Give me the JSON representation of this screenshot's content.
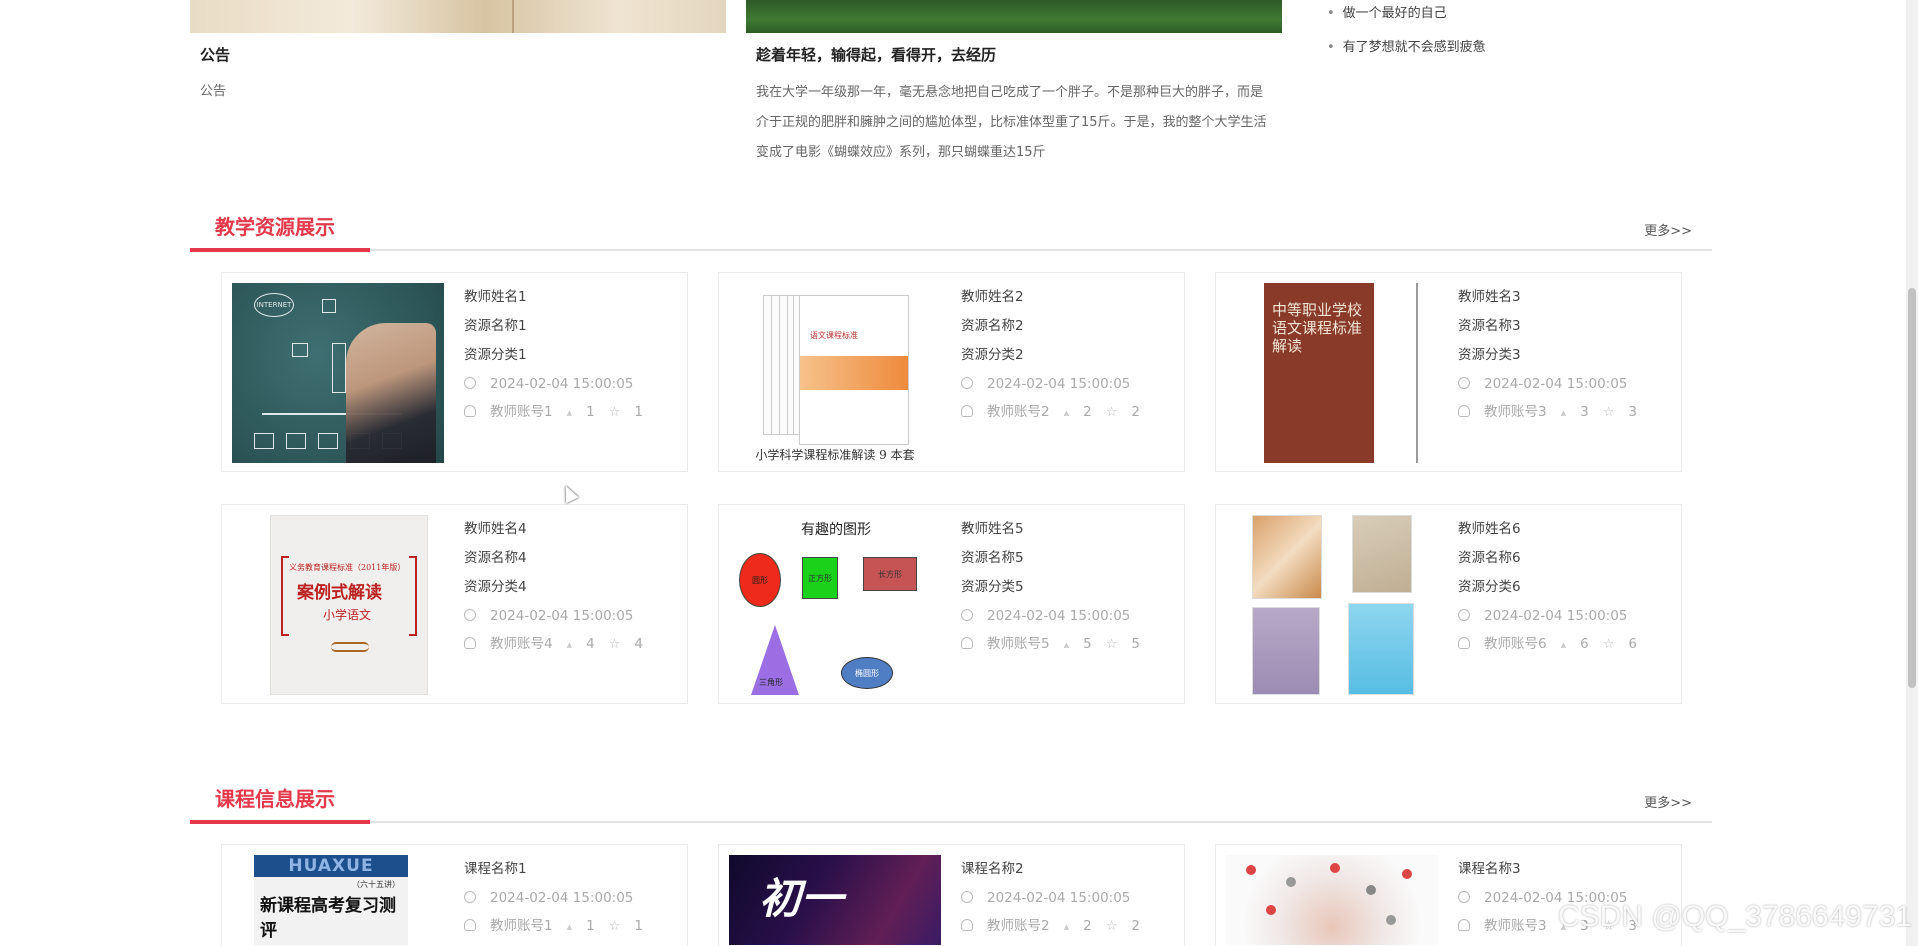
{
  "news": {
    "left_title": "公告",
    "left_sub": "公告",
    "mid_title": "趁着年轻，输得起，看得开，去经历",
    "mid_body": "我在大学一年级那一年，毫无悬念地把自己吃成了一个胖子。不是那种巨大的胖子，而是介于正规的肥胖和臃肿之间的尴尬体型，比标准体型重了15斤。于是，我的整个大学生活变成了电影《蝴蝶效应》系列，那只蝴蝶重达15斤",
    "side_items": [
      "做一个最好的自己",
      "有了梦想就不会感到疲惫"
    ]
  },
  "resources": {
    "title": "教学资源展示",
    "more": "更多>>",
    "cards": [
      {
        "teacher": "教师姓名1",
        "name": "资源名称1",
        "category": "资源分类1",
        "time": "2024-02-04 15:00:05",
        "account": "教师账号1",
        "likes": "1",
        "favs": "1"
      },
      {
        "teacher": "教师姓名2",
        "name": "资源名称2",
        "category": "资源分类2",
        "time": "2024-02-04 15:00:05",
        "account": "教师账号2",
        "likes": "2",
        "favs": "2"
      },
      {
        "teacher": "教师姓名3",
        "name": "资源名称3",
        "category": "资源分类3",
        "time": "2024-02-04 15:00:05",
        "account": "教师账号3",
        "likes": "3",
        "favs": "3"
      },
      {
        "teacher": "教师姓名4",
        "name": "资源名称4",
        "category": "资源分类4",
        "time": "2024-02-04 15:00:05",
        "account": "教师账号4",
        "likes": "4",
        "favs": "4"
      },
      {
        "teacher": "教师姓名5",
        "name": "资源名称5",
        "category": "资源分类5",
        "time": "2024-02-04 15:00:05",
        "account": "教师账号5",
        "likes": "5",
        "favs": "5"
      },
      {
        "teacher": "教师姓名6",
        "name": "资源名称6",
        "category": "资源分类6",
        "time": "2024-02-04 15:00:05",
        "account": "教师账号6",
        "likes": "6",
        "favs": "6"
      }
    ],
    "thumb_texts": {
      "chalk_cloud": "INTERNET",
      "books_caption": "小学科学课程标准解读 9 本套",
      "books_front": "语文课程标准",
      "brown_title": "中等职业学校 语文课程标准 解读",
      "case_t1": "义务教育课程标准（2011年版）",
      "case_t2": "案例式解读",
      "case_t3": "小学语文",
      "shapes_title": "有趣的图形",
      "shape_circle": "圆形",
      "shape_square": "正方形",
      "shape_rect": "长方形",
      "shape_tri": "三角形",
      "shape_ellipse": "椭圆形"
    }
  },
  "courses": {
    "title": "课程信息展示",
    "more": "更多>>",
    "cards": [
      {
        "name": "课程名称1",
        "time": "2024-02-04 15:00:05",
        "account": "教师账号1",
        "likes": "1",
        "favs": "1"
      },
      {
        "name": "课程名称2",
        "time": "2024-02-04 15:00:05",
        "account": "教师账号2",
        "likes": "2",
        "favs": "2"
      },
      {
        "name": "课程名称3",
        "time": "2024-02-04 15:00:05",
        "account": "教师账号3",
        "likes": "3",
        "favs": "3"
      }
    ],
    "thumb_texts": {
      "hua_top": "HUAXUE",
      "hua_title": "新课程高考复习测评",
      "hua_sub": "（六十五讲）",
      "chu": "初一"
    }
  },
  "watermark": "CSDN @QQ_3786649731",
  "colors": {
    "accent": "#e3394b"
  }
}
